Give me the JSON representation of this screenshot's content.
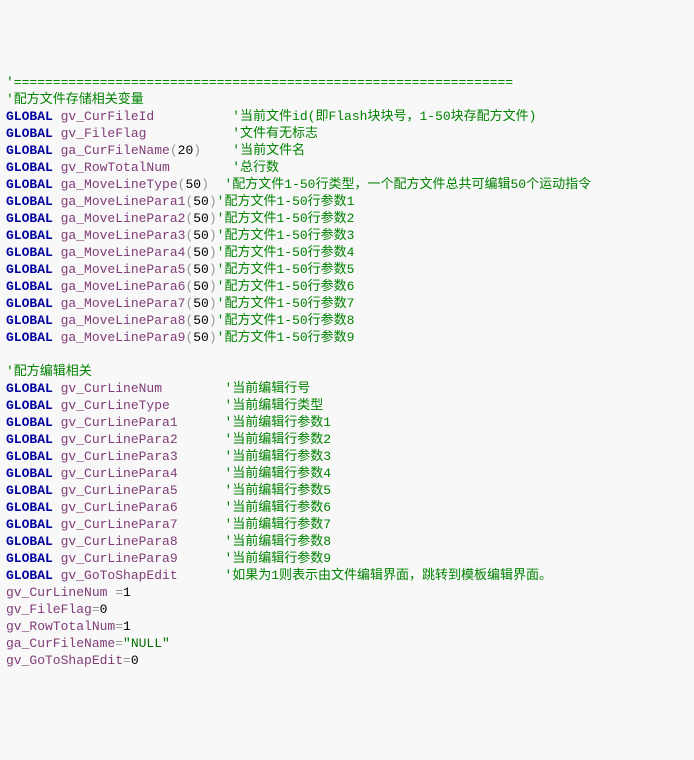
{
  "lines": [
    {
      "segs": [
        {
          "cls": "c",
          "t": "'================================================================"
        }
      ]
    },
    {
      "segs": [
        {
          "cls": "c",
          "t": "'配方文件存储相关变量"
        }
      ]
    },
    {
      "segs": [
        {
          "cls": "kw",
          "t": "GLOBAL "
        },
        {
          "cls": "id",
          "t": "gv_CurFileId          "
        },
        {
          "cls": "c",
          "t": "'当前文件id(即Flash块块号，1-50块存配方文件)"
        }
      ]
    },
    {
      "segs": [
        {
          "cls": "kw",
          "t": "GLOBAL "
        },
        {
          "cls": "id",
          "t": "gv_FileFlag           "
        },
        {
          "cls": "c",
          "t": "'文件有无标志"
        }
      ]
    },
    {
      "segs": [
        {
          "cls": "kw",
          "t": "GLOBAL "
        },
        {
          "cls": "id",
          "t": "ga_CurFileName"
        },
        {
          "cls": "p",
          "t": "("
        },
        {
          "cls": "n",
          "t": "20"
        },
        {
          "cls": "p",
          "t": ")    "
        },
        {
          "cls": "c",
          "t": "'当前文件名"
        }
      ]
    },
    {
      "segs": [
        {
          "cls": "kw",
          "t": "GLOBAL "
        },
        {
          "cls": "id",
          "t": "gv_RowTotalNum        "
        },
        {
          "cls": "c",
          "t": "'总行数"
        }
      ]
    },
    {
      "segs": [
        {
          "cls": "kw",
          "t": "GLOBAL "
        },
        {
          "cls": "id",
          "t": "ga_MoveLineType"
        },
        {
          "cls": "p",
          "t": "("
        },
        {
          "cls": "n",
          "t": "50"
        },
        {
          "cls": "p",
          "t": ")  "
        },
        {
          "cls": "c",
          "t": "'配方文件1-50行类型，一个配方文件总共可编辑50个运动指令"
        }
      ]
    },
    {
      "segs": [
        {
          "cls": "kw",
          "t": "GLOBAL "
        },
        {
          "cls": "id",
          "t": "ga_MoveLinePara1"
        },
        {
          "cls": "p",
          "t": "("
        },
        {
          "cls": "n",
          "t": "50"
        },
        {
          "cls": "p",
          "t": ")"
        },
        {
          "cls": "c",
          "t": "'配方文件1-50行参数1"
        }
      ]
    },
    {
      "segs": [
        {
          "cls": "kw",
          "t": "GLOBAL "
        },
        {
          "cls": "id",
          "t": "ga_MoveLinePara2"
        },
        {
          "cls": "p",
          "t": "("
        },
        {
          "cls": "n",
          "t": "50"
        },
        {
          "cls": "p",
          "t": ")"
        },
        {
          "cls": "c",
          "t": "'配方文件1-50行参数2"
        }
      ]
    },
    {
      "segs": [
        {
          "cls": "kw",
          "t": "GLOBAL "
        },
        {
          "cls": "id",
          "t": "ga_MoveLinePara3"
        },
        {
          "cls": "p",
          "t": "("
        },
        {
          "cls": "n",
          "t": "50"
        },
        {
          "cls": "p",
          "t": ")"
        },
        {
          "cls": "c",
          "t": "'配方文件1-50行参数3"
        }
      ]
    },
    {
      "segs": [
        {
          "cls": "kw",
          "t": "GLOBAL "
        },
        {
          "cls": "id",
          "t": "ga_MoveLinePara4"
        },
        {
          "cls": "p",
          "t": "("
        },
        {
          "cls": "n",
          "t": "50"
        },
        {
          "cls": "p",
          "t": ")"
        },
        {
          "cls": "c",
          "t": "'配方文件1-50行参数4"
        }
      ]
    },
    {
      "segs": [
        {
          "cls": "kw",
          "t": "GLOBAL "
        },
        {
          "cls": "id",
          "t": "ga_MoveLinePara5"
        },
        {
          "cls": "p",
          "t": "("
        },
        {
          "cls": "n",
          "t": "50"
        },
        {
          "cls": "p",
          "t": ")"
        },
        {
          "cls": "c",
          "t": "'配方文件1-50行参数5"
        }
      ]
    },
    {
      "segs": [
        {
          "cls": "kw",
          "t": "GLOBAL "
        },
        {
          "cls": "id",
          "t": "ga_MoveLinePara6"
        },
        {
          "cls": "p",
          "t": "("
        },
        {
          "cls": "n",
          "t": "50"
        },
        {
          "cls": "p",
          "t": ")"
        },
        {
          "cls": "c",
          "t": "'配方文件1-50行参数6"
        }
      ]
    },
    {
      "segs": [
        {
          "cls": "kw",
          "t": "GLOBAL "
        },
        {
          "cls": "id",
          "t": "ga_MoveLinePara7"
        },
        {
          "cls": "p",
          "t": "("
        },
        {
          "cls": "n",
          "t": "50"
        },
        {
          "cls": "p",
          "t": ")"
        },
        {
          "cls": "c",
          "t": "'配方文件1-50行参数7"
        }
      ]
    },
    {
      "segs": [
        {
          "cls": "kw",
          "t": "GLOBAL "
        },
        {
          "cls": "id",
          "t": "ga_MoveLinePara8"
        },
        {
          "cls": "p",
          "t": "("
        },
        {
          "cls": "n",
          "t": "50"
        },
        {
          "cls": "p",
          "t": ")"
        },
        {
          "cls": "c",
          "t": "'配方文件1-50行参数8"
        }
      ]
    },
    {
      "segs": [
        {
          "cls": "kw",
          "t": "GLOBAL "
        },
        {
          "cls": "id",
          "t": "ga_MoveLinePara9"
        },
        {
          "cls": "p",
          "t": "("
        },
        {
          "cls": "n",
          "t": "50"
        },
        {
          "cls": "p",
          "t": ")"
        },
        {
          "cls": "c",
          "t": "'配方文件1-50行参数9"
        }
      ]
    },
    {
      "segs": [
        {
          "cls": "p",
          "t": " "
        }
      ]
    },
    {
      "segs": [
        {
          "cls": "c",
          "t": "'配方编辑相关"
        }
      ]
    },
    {
      "segs": [
        {
          "cls": "kw",
          "t": "GLOBAL "
        },
        {
          "cls": "id",
          "t": "gv_CurLineNum        "
        },
        {
          "cls": "c",
          "t": "'当前编辑行号"
        }
      ]
    },
    {
      "segs": [
        {
          "cls": "kw",
          "t": "GLOBAL "
        },
        {
          "cls": "id",
          "t": "gv_CurLineType       "
        },
        {
          "cls": "c",
          "t": "'当前编辑行类型"
        }
      ]
    },
    {
      "segs": [
        {
          "cls": "kw",
          "t": "GLOBAL "
        },
        {
          "cls": "id",
          "t": "gv_CurLinePara1      "
        },
        {
          "cls": "c",
          "t": "'当前编辑行参数1"
        }
      ]
    },
    {
      "segs": [
        {
          "cls": "kw",
          "t": "GLOBAL "
        },
        {
          "cls": "id",
          "t": "gv_CurLinePara2      "
        },
        {
          "cls": "c",
          "t": "'当前编辑行参数2"
        }
      ]
    },
    {
      "segs": [
        {
          "cls": "kw",
          "t": "GLOBAL "
        },
        {
          "cls": "id",
          "t": "gv_CurLinePara3      "
        },
        {
          "cls": "c",
          "t": "'当前编辑行参数3"
        }
      ]
    },
    {
      "segs": [
        {
          "cls": "kw",
          "t": "GLOBAL "
        },
        {
          "cls": "id",
          "t": "gv_CurLinePara4      "
        },
        {
          "cls": "c",
          "t": "'当前编辑行参数4"
        }
      ]
    },
    {
      "segs": [
        {
          "cls": "kw",
          "t": "GLOBAL "
        },
        {
          "cls": "id",
          "t": "gv_CurLinePara5      "
        },
        {
          "cls": "c",
          "t": "'当前编辑行参数5"
        }
      ]
    },
    {
      "segs": [
        {
          "cls": "kw",
          "t": "GLOBAL "
        },
        {
          "cls": "id",
          "t": "gv_CurLinePara6      "
        },
        {
          "cls": "c",
          "t": "'当前编辑行参数6"
        }
      ]
    },
    {
      "segs": [
        {
          "cls": "kw",
          "t": "GLOBAL "
        },
        {
          "cls": "id",
          "t": "gv_CurLinePara7      "
        },
        {
          "cls": "c",
          "t": "'当前编辑行参数7"
        }
      ]
    },
    {
      "segs": [
        {
          "cls": "kw",
          "t": "GLOBAL "
        },
        {
          "cls": "id",
          "t": "gv_CurLinePara8      "
        },
        {
          "cls": "c",
          "t": "'当前编辑行参数8"
        }
      ]
    },
    {
      "segs": [
        {
          "cls": "kw",
          "t": "GLOBAL "
        },
        {
          "cls": "id",
          "t": "gv_CurLinePara9      "
        },
        {
          "cls": "c",
          "t": "'当前编辑行参数9"
        }
      ]
    },
    {
      "segs": [
        {
          "cls": "kw",
          "t": "GLOBAL "
        },
        {
          "cls": "id",
          "t": "gv_GoToShapEdit      "
        },
        {
          "cls": "c",
          "t": "'如果为1则表示由文件编辑界面，跳转到模板编辑界面。"
        }
      ]
    },
    {
      "segs": [
        {
          "cls": "id",
          "t": "gv_CurLineNum "
        },
        {
          "cls": "p",
          "t": "="
        },
        {
          "cls": "n",
          "t": "1"
        }
      ]
    },
    {
      "segs": [
        {
          "cls": "id",
          "t": "gv_FileFlag"
        },
        {
          "cls": "p",
          "t": "="
        },
        {
          "cls": "n",
          "t": "0"
        }
      ]
    },
    {
      "segs": [
        {
          "cls": "id",
          "t": "gv_RowTotalNum"
        },
        {
          "cls": "p",
          "t": "="
        },
        {
          "cls": "n",
          "t": "1"
        }
      ]
    },
    {
      "segs": [
        {
          "cls": "id",
          "t": "ga_CurFileName"
        },
        {
          "cls": "p",
          "t": "="
        },
        {
          "cls": "s",
          "t": "\"NULL\""
        }
      ]
    },
    {
      "segs": [
        {
          "cls": "id",
          "t": "gv_GoToShapEdit"
        },
        {
          "cls": "p",
          "t": "="
        },
        {
          "cls": "n",
          "t": "0"
        }
      ]
    }
  ]
}
